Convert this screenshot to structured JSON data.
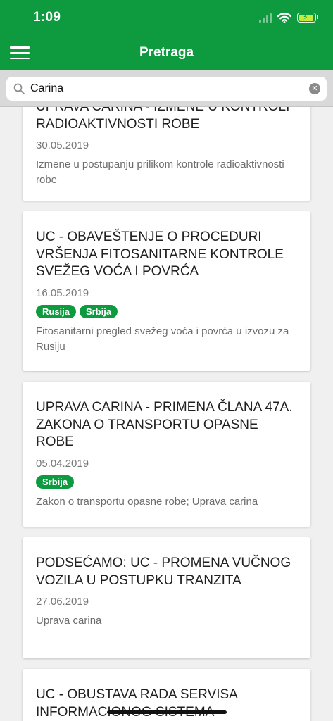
{
  "status_bar": {
    "time": "1:09"
  },
  "header": {
    "title": "Pretraga"
  },
  "search": {
    "value": "Carina",
    "placeholder": ""
  },
  "results": [
    {
      "title": "UPRAVA CARINA - IZMENE U KONTROLI RADIOAKTIVNOSTI ROBE",
      "date": "30.05.2019",
      "tags": [],
      "description": "Izmene u postupanju prilikom kontrole radioaktivnosti robe"
    },
    {
      "title": "UC - OBAVEŠTENJE O PROCEDURI VRŠENJA FITOSANITARNE KONTROLE SVEŽEG VOĆA I POVRĆA",
      "date": "16.05.2019",
      "tags": [
        "Rusija",
        "Srbija"
      ],
      "description": "Fitosanitarni pregled svežeg voća i povrća u izvozu za Rusiju"
    },
    {
      "title": "UPRAVA CARINA - PRIMENA ČLANA 47a. ZAKONA O TRANSPORTU OPASNE ROBE",
      "date": "05.04.2019",
      "tags": [
        "Srbija"
      ],
      "description": "Zakon o transportu opasne robe; Uprava carina"
    },
    {
      "title": "PODSEĆAMO: UC - PROMENA VUČNOG VOZILA U POSTUPKU TRANZITA",
      "date": "27.06.2019",
      "tags": [],
      "description": "Uprava carina"
    },
    {
      "title": "UC - OBUSTAVA RADA SERVISA INFORMACIONOG SISTEMA",
      "date": "",
      "tags": [],
      "description": ""
    }
  ],
  "colors": {
    "brand_green": "#0e9a3e",
    "battery_fill": "#c5ec3a"
  }
}
